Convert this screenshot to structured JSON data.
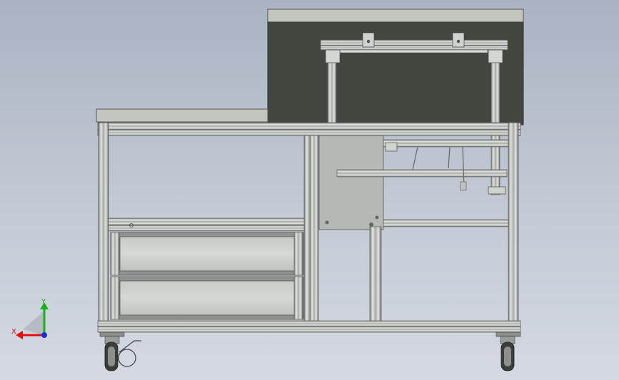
{
  "viewport": {
    "background_top": "#a9b3c2",
    "background_bottom": "#d4d9e2"
  },
  "model": {
    "description_visible": false,
    "colors": {
      "aluminum": "#c9ccc8",
      "aluminum_dark": "#6c706c",
      "aluminum_light": "#e6e8e4",
      "panel_dark": "#43463f",
      "worktop": "#c3c6bf",
      "plate": "#b6b9b3",
      "wheel": "#3a3d39"
    }
  },
  "triad": {
    "x_label": "X",
    "y_label": "Y",
    "x_color": "#e01010",
    "y_color": "#18b018",
    "z_color": "#1a2fe0"
  }
}
